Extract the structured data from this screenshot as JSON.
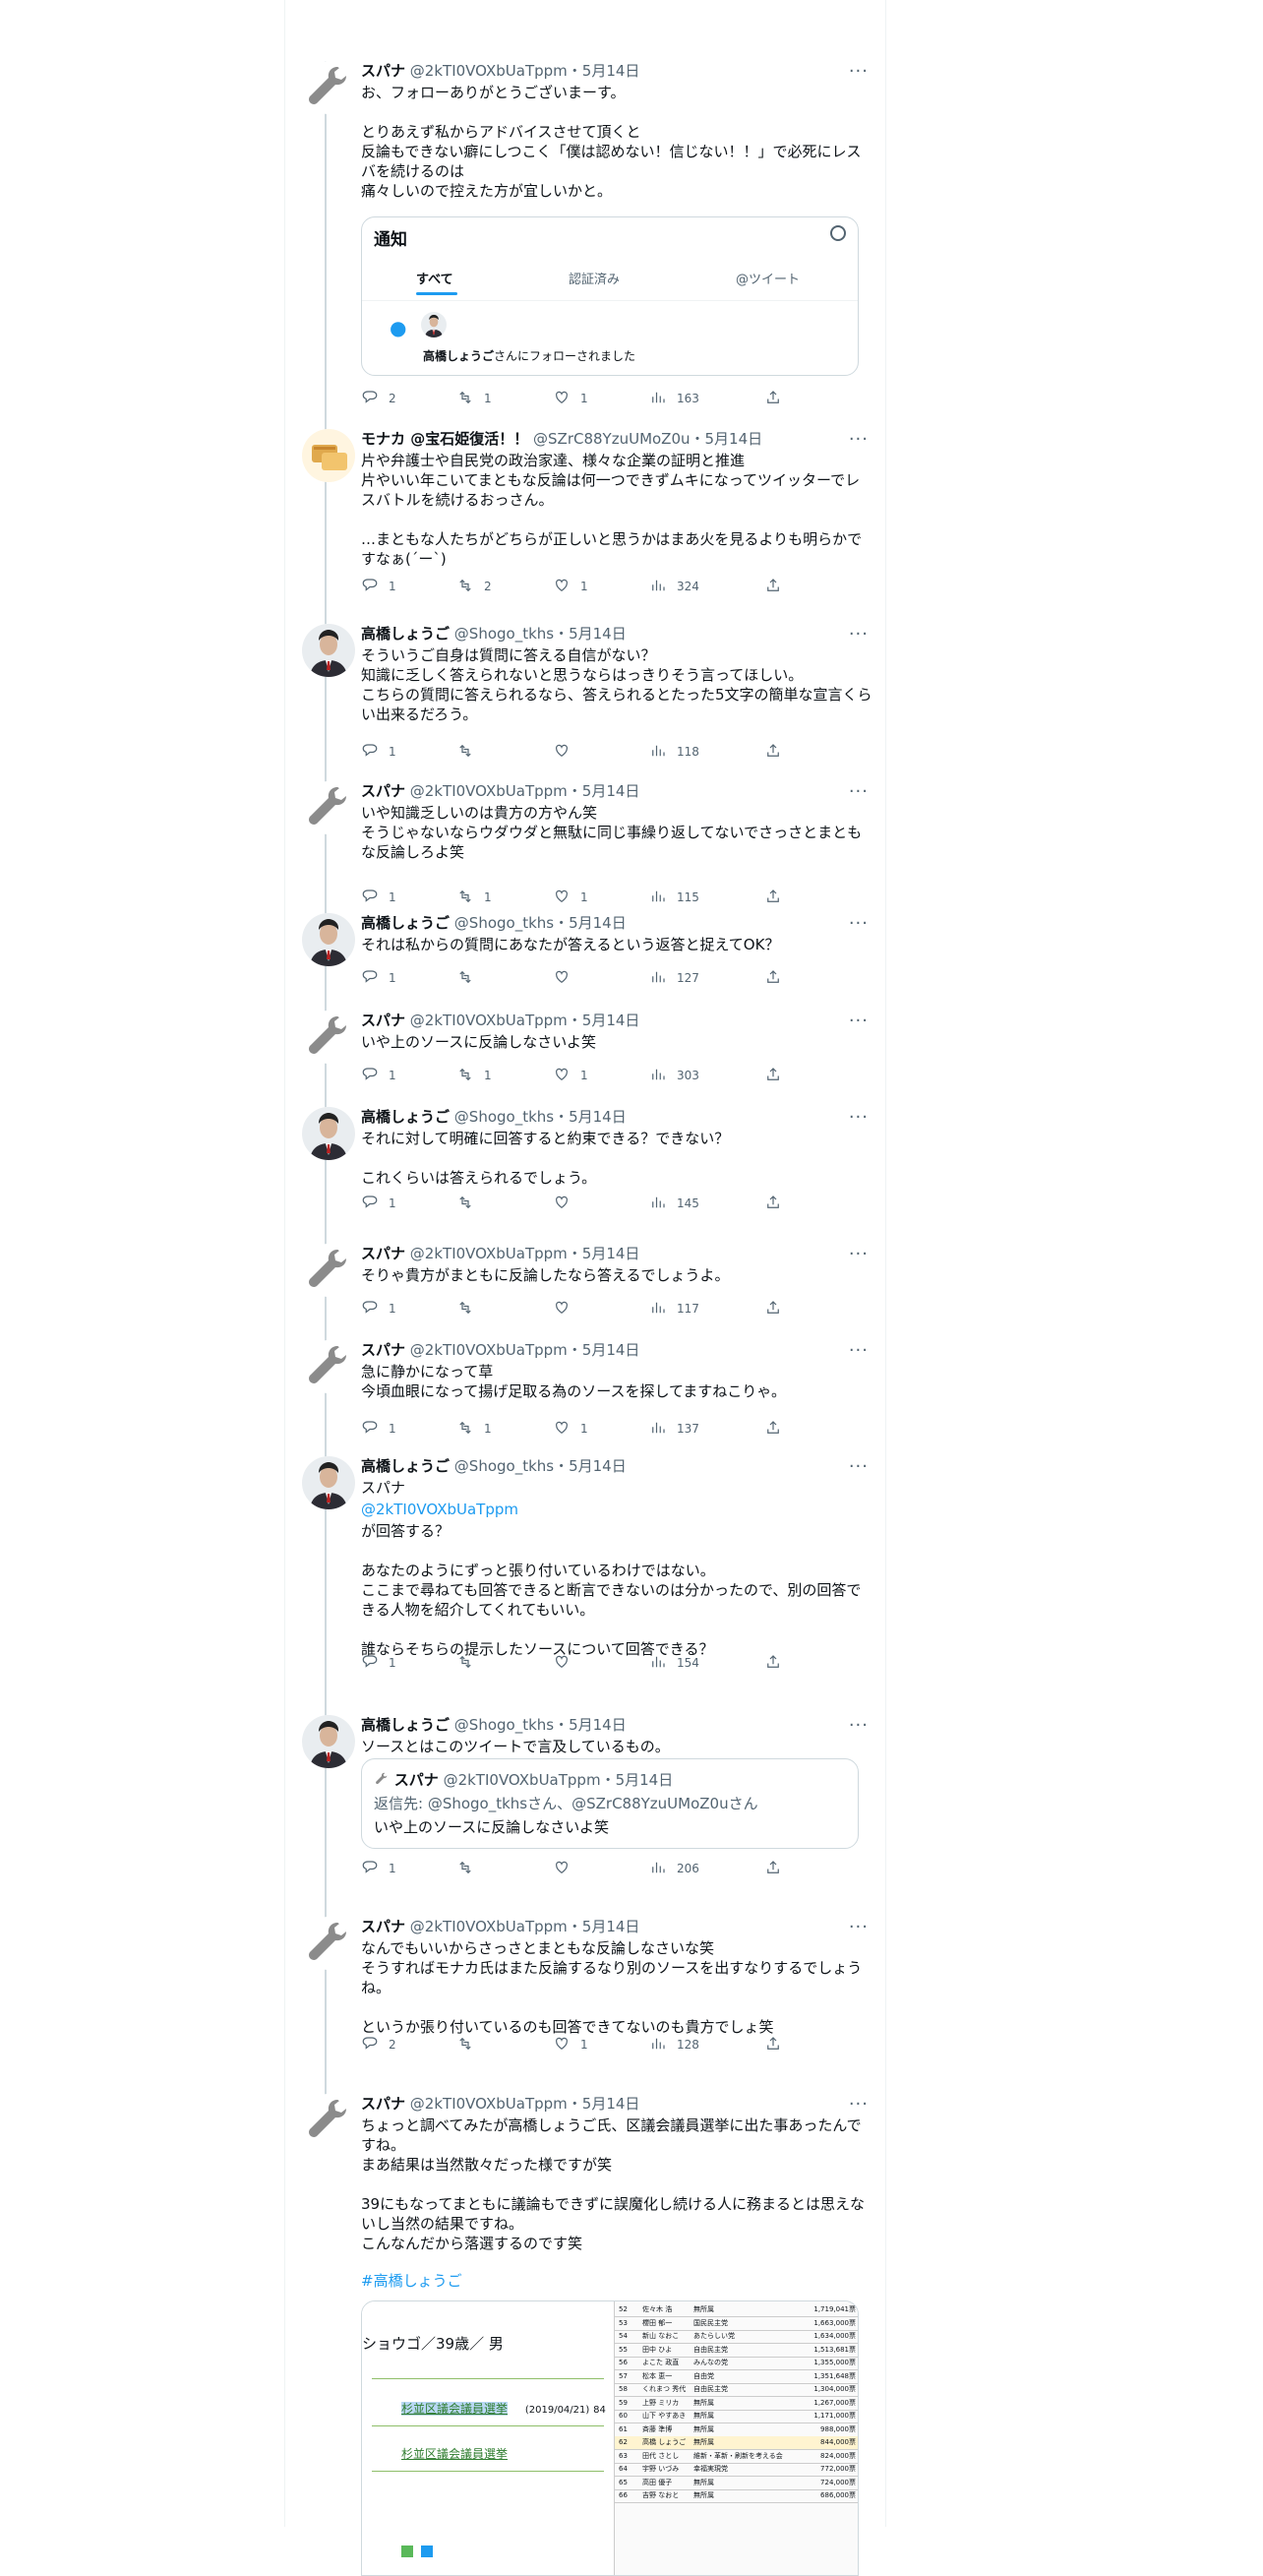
{
  "tweets": [
    {
      "name": "スパナ",
      "handle": "@2kTI0VOXbUaTppm",
      "date": "・5月14日",
      "avatar": "wrench-icon",
      "text": "お、フォローありがとうございまーす。\n\nとりあえず私からアドバイスさせて頂くと\n反論もできない癖にしつこく「僕は認めない！信じない！！」で必死にレスバを続けるのは\n痛々しいので控えた方が宜しいかと。",
      "reply": "2",
      "retweet": "1",
      "like": "1",
      "views": "163"
    },
    {
      "name": "モナカ @宝石姫復活！！",
      "handle": "@SZrC88YzuUMoZ0u",
      "date": "・5月14日",
      "avatar": "monaka-avatar",
      "text": "片や弁護士や自民党の政治家達、様々な企業の証明と推進\n片やいい年こいてまともな反論は何一つできずムキになってツイッターでレスバトルを続けるおっさん。\n\n…まともな人たちがどちらが正しいと思うかはまあ火を見るよりも明らかですなぁ(´ー`)",
      "reply": "1",
      "retweet": "2",
      "like": "1",
      "views": "324"
    },
    {
      "name": "高橋しょうご",
      "handle": "@Shogo_tkhs",
      "date": "・5月14日",
      "avatar": "person-avatar",
      "text": "そういうご自身は質問に答える自信がない？\n知識に乏しく答えられないと思うならはっきりそう言ってほしい。\nこちらの質問に答えられるなら、答えられるとたった5文字の簡単な宣言くらい出来るだろう。",
      "reply": "1",
      "retweet": "",
      "like": "",
      "views": "118"
    },
    {
      "name": "スパナ",
      "handle": "@2kTI0VOXbUaTppm",
      "date": "・5月14日",
      "avatar": "wrench-icon",
      "text": "いや知識乏しいのは貴方の方やん笑\nそうじゃないならウダウダと無駄に同じ事繰り返してないでさっさとまともな反論しろよ笑",
      "reply": "1",
      "retweet": "1",
      "like": "1",
      "views": "115"
    },
    {
      "name": "高橋しょうご",
      "handle": "@Shogo_tkhs",
      "date": "・5月14日",
      "avatar": "person-avatar",
      "text": "それは私からの質問にあなたが答えるという返答と捉えてOK？",
      "reply": "1",
      "retweet": "",
      "like": "",
      "views": "127"
    },
    {
      "name": "スパナ",
      "handle": "@2kTI0VOXbUaTppm",
      "date": "・5月14日",
      "avatar": "wrench-icon",
      "text": "いや上のソースに反論しなさいよ笑",
      "reply": "1",
      "retweet": "1",
      "like": "1",
      "views": "303"
    },
    {
      "name": "高橋しょうご",
      "handle": "@Shogo_tkhs",
      "date": "・5月14日",
      "avatar": "person-avatar",
      "text": "それに対して明確に回答すると約束できる？できない？\n\nこれくらいは答えられるでしょう。",
      "reply": "1",
      "retweet": "",
      "like": "",
      "views": "145"
    },
    {
      "name": "スパナ",
      "handle": "@2kTI0VOXbUaTppm",
      "date": "・5月14日",
      "avatar": "wrench-icon",
      "text": "そりゃ貴方がまともに反論したなら答えるでしょうよ。",
      "reply": "1",
      "retweet": "",
      "like": "",
      "views": "117"
    },
    {
      "name": "スパナ",
      "handle": "@2kTI0VOXbUaTppm",
      "date": "・5月14日",
      "avatar": "wrench-icon",
      "text": "急に静かになって草\n今頃血眼になって揚げ足取る為のソースを探してますねこりゃ。",
      "reply": "1",
      "retweet": "1",
      "like": "1",
      "views": "137"
    },
    {
      "name": "高橋しょうご",
      "handle": "@Shogo_tkhs",
      "date": "・5月14日",
      "avatar": "person-avatar",
      "text_a": "スパナ",
      "mention": "@2kTI0VOXbUaTppm",
      "text": "が回答する？\n\nあなたのようにずっと張り付いているわけではない。\nここまで尋ねても回答できると断言できないのは分かったので、別の回答できる人物を紹介してくれてもいい。\n\n誰ならそちらの提示したソースについて回答できる？",
      "reply": "1",
      "retweet": "",
      "like": "",
      "views": "154"
    },
    {
      "name": "高橋しょうご",
      "handle": "@Shogo_tkhs",
      "date": "・5月14日",
      "avatar": "person-avatar",
      "text": "ソースとはこのツイートで言及しているもの。",
      "reply": "1",
      "retweet": "",
      "like": "",
      "views": "206"
    },
    {
      "name": "スパナ",
      "handle": "@2kTI0VOXbUaTppm",
      "date": "・5月14日",
      "avatar": "wrench-icon",
      "text": "なんでもいいからさっさとまともな反論しなさいな笑\nそうすればモナカ氏はまた反論するなり別のソースを出すなりするでしょうね。\n\nというか張り付いているのも回答できてないのも貴方でしょ笑",
      "reply": "2",
      "retweet": "",
      "like": "1",
      "views": "128"
    },
    {
      "name": "スパナ",
      "handle": "@2kTI0VOXbUaTppm",
      "date": "・5月14日",
      "avatar": "wrench-icon",
      "text": "ちょっと調べてみたが高橋しょうご氏、区議会議員選挙に出た事あったんですね。\nまあ結果は当然散々だった様ですが笑\n\n39にもなってまともに議論もできずに誤魔化し続ける人に務まるとは思えないし当然の結果ですね。\nこんなんだから落選するのです笑",
      "hashtag": "#高橋しょうご"
    }
  ],
  "notif_card": {
    "title": "通知",
    "tabs": [
      "すべて",
      "認証済み",
      "@ツイート"
    ],
    "follow_name": "高橋しょうご",
    "follow_text": "さんにフォローされました"
  },
  "quote": {
    "name": "スパナ",
    "handle": "@2kTI0VOXbUaTppm",
    "date": "・5月14日",
    "reply_to": "返信先: @Shogo_tkhsさん、@SZrC88YzuUMoZ0uさん",
    "text": "いや上のソースに反論しなさいよ笑"
  },
  "image_card": {
    "heading": "ショウゴ／39歳／ 男",
    "link1": "杉並区議会議員選挙",
    "link1_date": "(2019/04/21)",
    "link1_extra": "84",
    "link2": "杉並区議会議員選挙",
    "table": [
      [
        "52",
        "佐々木 浩",
        "無所属",
        "1,719,041票"
      ],
      [
        "53",
        "櫻田 郁一",
        "国民民主党",
        "1,663,000票"
      ],
      [
        "54",
        "新山 なおこ",
        "あたらしい党",
        "1,634,000票"
      ],
      [
        "55",
        "田中 ひよ",
        "自由民主党",
        "1,513,681票"
      ],
      [
        "56",
        "よこた 政直",
        "みんなの党",
        "1,355,000票"
      ],
      [
        "57",
        "松本 恵一",
        "自由党",
        "1,351,648票"
      ],
      [
        "58",
        "くれまつ 秀代",
        "自由民主党",
        "1,304,000票"
      ],
      [
        "59",
        "上野 ミリカ",
        "無所属",
        "1,267,000票"
      ],
      [
        "60",
        "山下 やすあき",
        "無所属",
        "1,171,000票"
      ],
      [
        "61",
        "斉藤 準博",
        "無所属",
        "988,000票"
      ],
      [
        "62",
        "高橋 しょうご",
        "無所属",
        "844,000票"
      ],
      [
        "63",
        "田代 さとし",
        "維新・革新・刷新を考える会",
        "824,000票"
      ],
      [
        "64",
        "宇野 いづみ",
        "幸福実現党",
        "772,000票"
      ],
      [
        "65",
        "高田 優子",
        "無所属",
        "724,000票"
      ],
      [
        "66",
        "吉野 なおと",
        "無所属",
        "686,000票"
      ]
    ]
  },
  "colors": {
    "text": "#0f1419",
    "secondary": "#536471",
    "link": "#1d9bf0",
    "border": "#cfd9de"
  }
}
